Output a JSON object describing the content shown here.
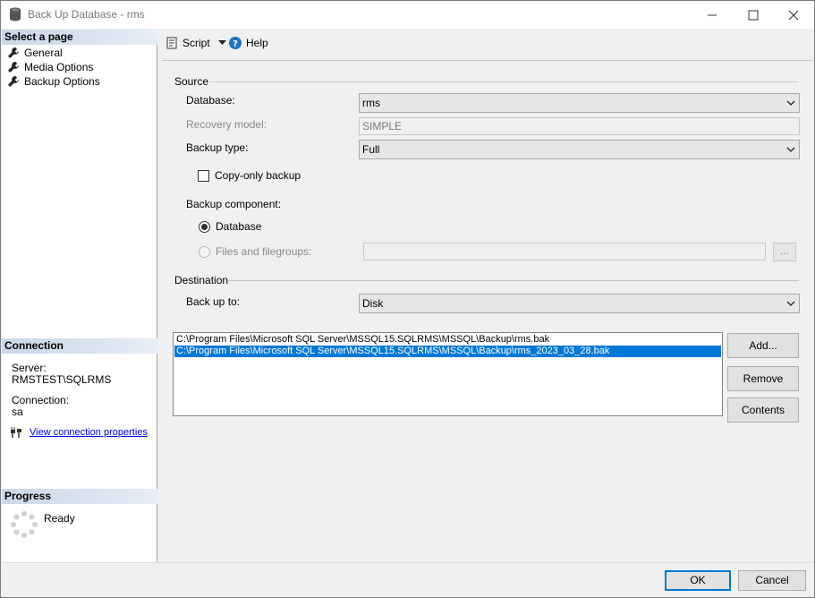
{
  "window": {
    "title": "Back Up Database - rms"
  },
  "left": {
    "select_page_header": "Select a page",
    "pages": [
      {
        "label": "General"
      },
      {
        "label": "Media Options"
      },
      {
        "label": "Backup Options"
      }
    ],
    "connection_header": "Connection",
    "server_label": "Server:",
    "server_value": "RMSTEST\\SQLRMS",
    "connection_label": "Connection:",
    "connection_value": "sa",
    "view_connection_link": "View connection properties",
    "progress_header": "Progress",
    "progress_status": "Ready"
  },
  "toolbar": {
    "script_label": "Script",
    "help_label": "Help"
  },
  "source": {
    "group_label": "Source",
    "database_label": "Database:",
    "database_value": "rms",
    "recovery_label": "Recovery model:",
    "recovery_value": "SIMPLE",
    "backup_type_label": "Backup type:",
    "backup_type_value": "Full",
    "copy_only_label": "Copy-only backup",
    "copy_only_checked": false,
    "component_label": "Backup component:",
    "component_database_label": "Database",
    "component_files_label": "Files and filegroups:",
    "ellipsis_label": "..."
  },
  "destination": {
    "group_label": "Destination",
    "backup_to_label": "Back up to:",
    "backup_to_value": "Disk",
    "files": [
      {
        "path": "C:\\Program Files\\Microsoft SQL Server\\MSSQL15.SQLRMS\\MSSQL\\Backup\\rms.bak",
        "selected": false
      },
      {
        "path": "C:\\Program Files\\Microsoft SQL Server\\MSSQL15.SQLRMS\\MSSQL\\Backup\\rms_2023_03_28.bak",
        "selected": true
      }
    ],
    "add_label": "Add...",
    "remove_label": "Remove",
    "contents_label": "Contents"
  },
  "footer": {
    "ok_label": "OK",
    "cancel_label": "Cancel"
  },
  "colors": {
    "selection": "#0078d7",
    "header_gradient": "#c9d7e8",
    "link": "#0000ee"
  }
}
